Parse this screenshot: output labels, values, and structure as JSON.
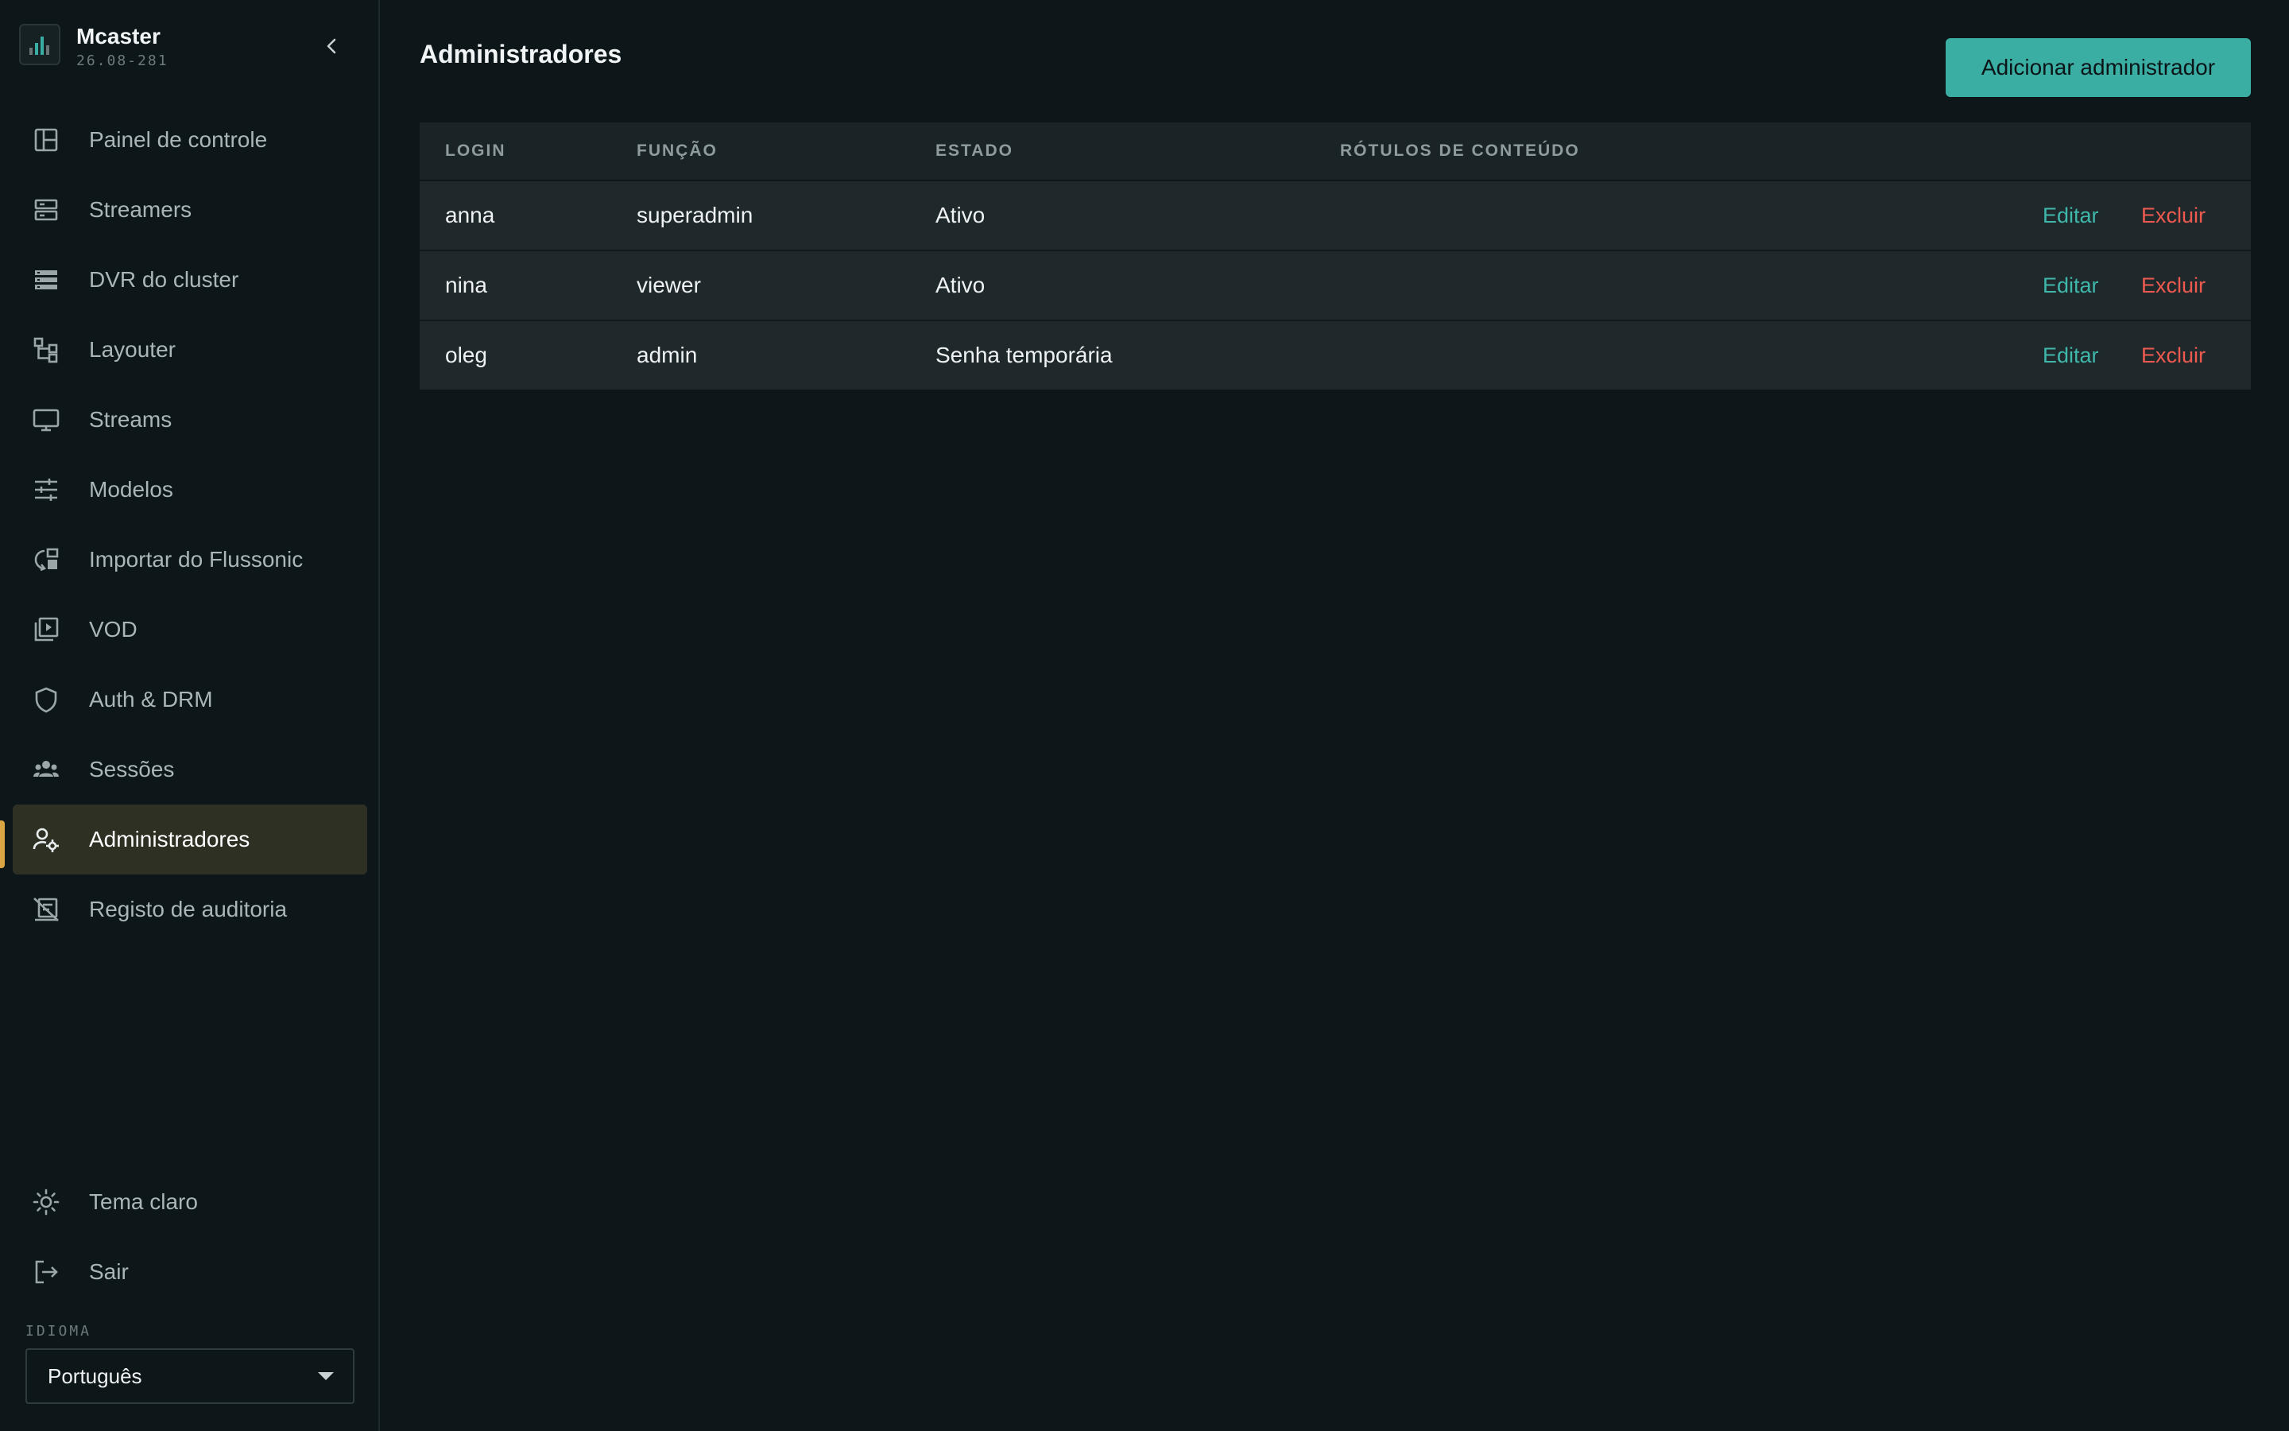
{
  "brand": {
    "name": "Mcaster",
    "version": "26.08-281"
  },
  "sidebar": {
    "items": [
      {
        "label": "Painel de controle",
        "icon": "dashboard-icon"
      },
      {
        "label": "Streamers",
        "icon": "server-icon"
      },
      {
        "label": "DVR do cluster",
        "icon": "storage-icon"
      },
      {
        "label": "Layouter",
        "icon": "layout-icon"
      },
      {
        "label": "Streams",
        "icon": "monitor-icon"
      },
      {
        "label": "Modelos",
        "icon": "sliders-icon"
      },
      {
        "label": "Importar do Flussonic",
        "icon": "import-icon"
      },
      {
        "label": "VOD",
        "icon": "video-library-icon"
      },
      {
        "label": "Auth & DRM",
        "icon": "shield-icon"
      },
      {
        "label": "Sessões",
        "icon": "group-icon"
      },
      {
        "label": "Administradores",
        "icon": "user-gear-icon",
        "active": true
      },
      {
        "label": "Registo de auditoria",
        "icon": "audit-icon"
      }
    ],
    "bottom": [
      {
        "label": "Tema claro",
        "icon": "sun-icon"
      },
      {
        "label": "Sair",
        "icon": "logout-icon"
      }
    ],
    "language": {
      "label": "IDIOMA",
      "value": "Português"
    }
  },
  "main": {
    "title": "Administradores",
    "add_button": "Adicionar administrador",
    "table": {
      "headers": [
        "LOGIN",
        "FUNÇÃO",
        "ESTADO",
        "RÓTULOS DE CONTEÚDO"
      ],
      "edit_label": "Editar",
      "delete_label": "Excluir",
      "rows": [
        {
          "login": "anna",
          "role": "superadmin",
          "state": "Ativo",
          "labels": ""
        },
        {
          "login": "nina",
          "role": "viewer",
          "state": "Ativo",
          "labels": ""
        },
        {
          "login": "oleg",
          "role": "admin",
          "state": "Senha temporária",
          "labels": ""
        }
      ]
    }
  },
  "colors": {
    "accent": "#3aaea3",
    "danger": "#ef5a50",
    "active_marker": "#d9a441",
    "background": "#0d1619"
  }
}
